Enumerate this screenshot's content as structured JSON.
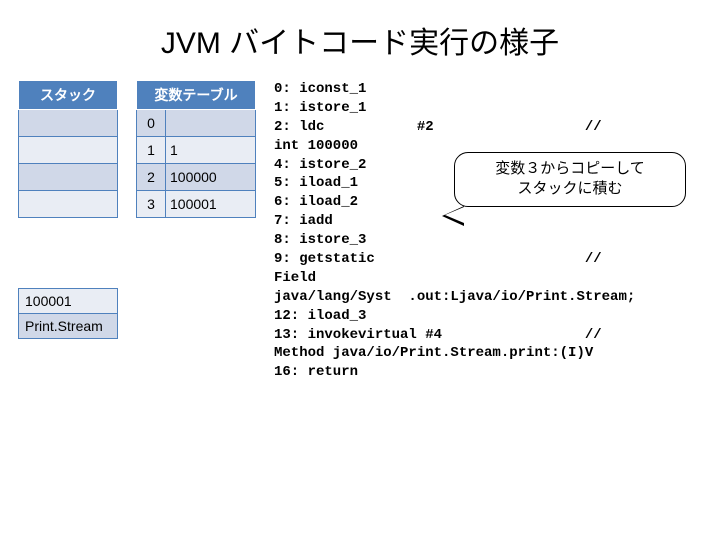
{
  "title": "JVM バイトコード実行の様子",
  "stack": {
    "header": "スタック",
    "rows_blank_count": 4,
    "lower": [
      "100001",
      "Print.Stream"
    ]
  },
  "vartable": {
    "header": "変数テーブル",
    "rows": [
      {
        "idx": "0",
        "val": ""
      },
      {
        "idx": "1",
        "val": "1"
      },
      {
        "idx": "2",
        "val": "100000"
      },
      {
        "idx": "3",
        "val": "100001"
      }
    ]
  },
  "callout": {
    "line1": "変数３からコピーして",
    "line2": "スタックに積む"
  },
  "code": {
    "l0": "0: iconst_1",
    "l1": "1: istore_1",
    "l2": "2: ldc           #2                  //",
    "l2b": "int 100000",
    "l3": "4: istore_2",
    "l4": "5: iload_1",
    "l5": "6: iload_2",
    "l6": "7: iadd",
    "l7": "8: istore_3",
    "l8": "9: getstatic                         //",
    "l8b": "Field",
    "l8c": "java/lang/Syst  .out:Ljava/io/Print.Stream;",
    "l9": "12: iload_3",
    "l10": "13: invokevirtual #4                 //",
    "l10b": "Method java/io/Print.Stream.print:(I)V",
    "l11": "16: return"
  }
}
